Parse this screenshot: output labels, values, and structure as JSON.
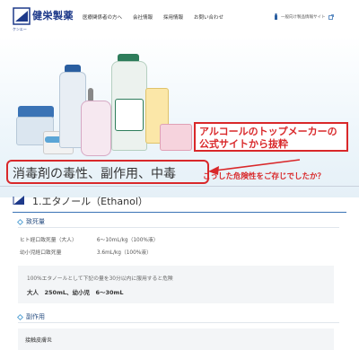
{
  "header": {
    "logo_text": "健栄製薬",
    "logo_sub": "ケンエー",
    "nav": [
      "医療関係者の方へ",
      "会社情報",
      "採用情報",
      "お問い合わせ"
    ],
    "external_link": "一般向け製品情報サイト"
  },
  "hero": {
    "callout": "アルコールのトップメーカーの公式サイトから抜粋",
    "question": "こうした危険性をご存じでしたか？"
  },
  "page": {
    "title": "消毒剤の毒性、副作用、中毒"
  },
  "section1": {
    "title": "1.エタノール（Ethanol）",
    "lethal_heading": "致死量",
    "rows": [
      {
        "label": "ヒト経口致死量（大人）",
        "value": "6～10mL/kg（100%液）"
      },
      {
        "label": "幼小児経口致死量",
        "value": "3.6mL/kg（100%液）"
      }
    ],
    "note_line1": "100%エタノールとして下記の量を30分以内に服用すると危険",
    "note_line2": "大人　250mL、幼小児　6～30mL",
    "side_effect_heading": "副作用",
    "side_effect_item": "接触皮膚炎"
  },
  "colors": {
    "accent_red": "#d9282a",
    "brand_blue": "#1e3a8a",
    "link_blue": "#3a73b5"
  }
}
